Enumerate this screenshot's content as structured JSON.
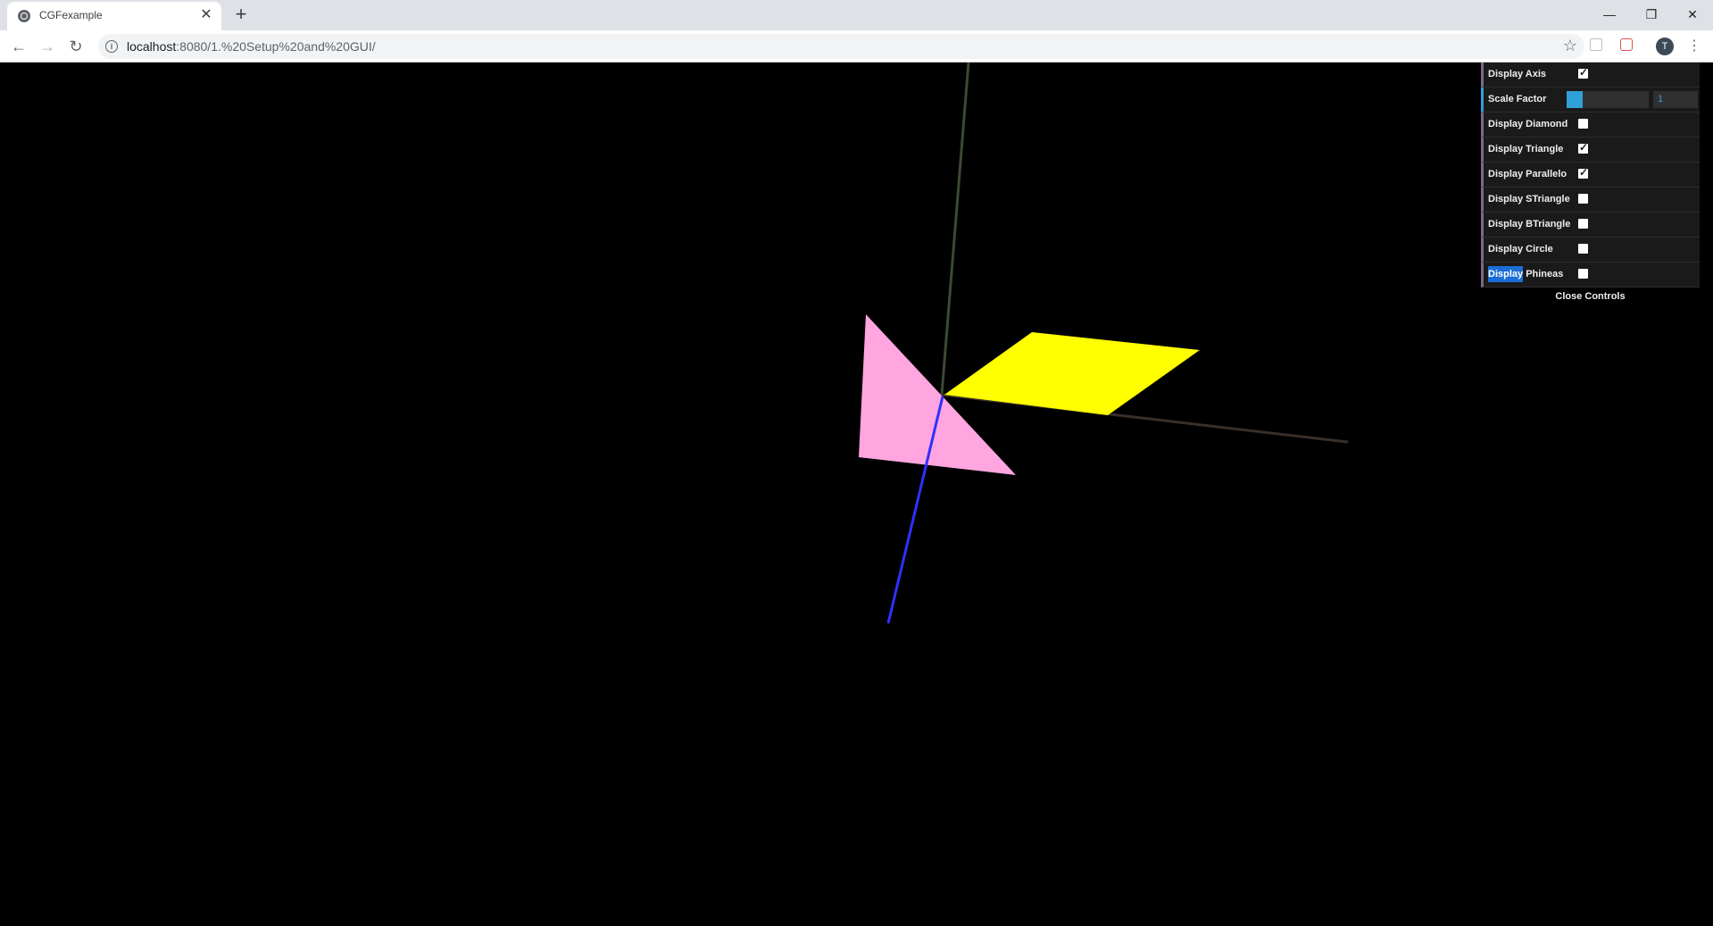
{
  "browser": {
    "tab_title": "CGFexample",
    "tab_close": "✕",
    "new_tab": "+",
    "url_host": "localhost",
    "url_path": ":8080/1.%20Setup%20and%20GUI/",
    "profile_initial": "T",
    "window_controls": {
      "minimize": "—",
      "restore": "❐",
      "close": "✕"
    },
    "nav": {
      "back": "←",
      "forward": "→",
      "reload": "↻"
    }
  },
  "scene": {
    "background": "#000000",
    "shapes": [
      {
        "name": "triangle",
        "color": "#ffa6e0"
      },
      {
        "name": "parallelogram",
        "color": "#ffff00"
      }
    ],
    "axis_colors": {
      "x": "#3a2f28",
      "y": "#3b4a35",
      "z": "#3030ff"
    }
  },
  "gui": {
    "controls": [
      {
        "label": "Display Axis",
        "type": "checkbox",
        "checked": true
      },
      {
        "label": "Scale Factor",
        "type": "number",
        "value": "1",
        "fill_fraction": 0.2
      },
      {
        "label": "Display Diamond",
        "type": "checkbox",
        "checked": false
      },
      {
        "label": "Display Triangle",
        "type": "checkbox",
        "checked": true
      },
      {
        "label": "Display Parallelo",
        "type": "checkbox",
        "checked": true
      },
      {
        "label": "Display STriangle",
        "type": "checkbox",
        "checked": false
      },
      {
        "label": "Display BTriangle",
        "type": "checkbox",
        "checked": false
      },
      {
        "label": "Display Circle",
        "type": "checkbox",
        "checked": false
      },
      {
        "label_highlight": "Display",
        "label_rest": " Phineas",
        "type": "checkbox",
        "checked": false
      }
    ],
    "close_label": "Close Controls",
    "accent_color": "#2fa1d6"
  }
}
